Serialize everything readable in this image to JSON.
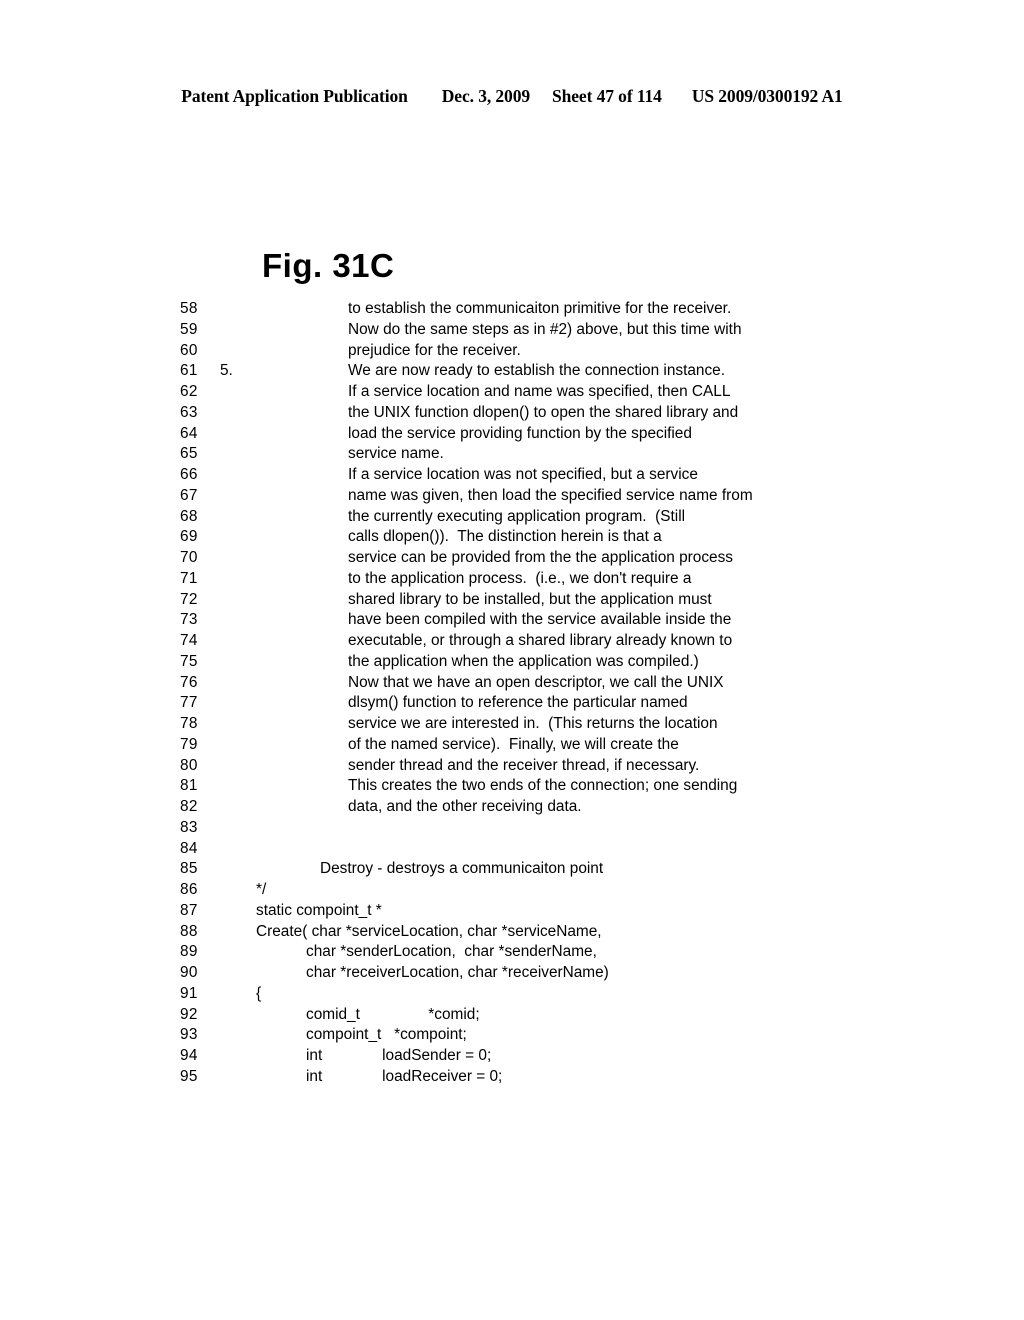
{
  "header": {
    "publication": "Patent Application Publication",
    "date": "Dec. 3, 2009",
    "sheet": "Sheet 47 of 114",
    "patent_number": "US 2009/0300192 A1"
  },
  "figure": {
    "title": "Fig. 31C"
  },
  "listing": {
    "lines": [
      {
        "number": "58",
        "marker": "",
        "indent": "text",
        "text": "to establish the communicaiton primitive for the receiver."
      },
      {
        "number": "59",
        "marker": "",
        "indent": "text",
        "text": "Now do the same steps as in #2) above, but this time with"
      },
      {
        "number": "60",
        "marker": "",
        "indent": "text",
        "text": "prejudice for the receiver."
      },
      {
        "number": "61",
        "marker": "5.",
        "indent": "text",
        "text": "We are now ready to establish the connection instance."
      },
      {
        "number": "62",
        "marker": "",
        "indent": "text",
        "text": "If a service location and name was specified, then CALL"
      },
      {
        "number": "63",
        "marker": "",
        "indent": "text",
        "text": "the UNIX function dlopen() to open the shared library and"
      },
      {
        "number": "64",
        "marker": "",
        "indent": "text",
        "text": "load the service providing function by the specified"
      },
      {
        "number": "65",
        "marker": "",
        "indent": "text",
        "text": "service name."
      },
      {
        "number": "66",
        "marker": "",
        "indent": "text",
        "text": "If a service location was not specified, but a service"
      },
      {
        "number": "67",
        "marker": "",
        "indent": "text",
        "text": "name was given, then load the specified service name from"
      },
      {
        "number": "68",
        "marker": "",
        "indent": "text",
        "text": "the currently executing application program.  (Still"
      },
      {
        "number": "69",
        "marker": "",
        "indent": "text",
        "text": "calls dlopen()).  The distinction herein is that a"
      },
      {
        "number": "70",
        "marker": "",
        "indent": "text",
        "text": "service can be provided from the the application process"
      },
      {
        "number": "71",
        "marker": "",
        "indent": "text",
        "text": "to the application process.  (i.e., we don't require a"
      },
      {
        "number": "72",
        "marker": "",
        "indent": "text",
        "text": "shared library to be installed, but the application must"
      },
      {
        "number": "73",
        "marker": "",
        "indent": "text",
        "text": "have been compiled with the service available inside the"
      },
      {
        "number": "74",
        "marker": "",
        "indent": "text",
        "text": "executable, or through a shared library already known to"
      },
      {
        "number": "75",
        "marker": "",
        "indent": "text",
        "text": "the application when the application was compiled.)"
      },
      {
        "number": "76",
        "marker": "",
        "indent": "text",
        "text": "Now that we have an open descriptor, we call the UNIX"
      },
      {
        "number": "77",
        "marker": "",
        "indent": "text",
        "text": "dlsym() function to reference the particular named"
      },
      {
        "number": "78",
        "marker": "",
        "indent": "text",
        "text": "service we are interested in.  (This returns the location"
      },
      {
        "number": "79",
        "marker": "",
        "indent": "text",
        "text": "of the named service).  Finally, we will create the"
      },
      {
        "number": "80",
        "marker": "",
        "indent": "text",
        "text": "sender thread and the receiver thread, if necessary."
      },
      {
        "number": "81",
        "marker": "",
        "indent": "text",
        "text": "This creates the two ends of the connection; one sending"
      },
      {
        "number": "82",
        "marker": "",
        "indent": "text",
        "text": "data, and the other receiving data."
      },
      {
        "number": "83",
        "marker": "",
        "indent": "text",
        "text": ""
      },
      {
        "number": "84",
        "marker": "",
        "indent": "text",
        "text": ""
      },
      {
        "number": "85",
        "marker": "",
        "indent": "cmt",
        "text": "Destroy - destroys a communicaiton point"
      },
      {
        "number": "86",
        "marker": "",
        "indent": "code0",
        "text": "*/"
      },
      {
        "number": "87",
        "marker": "",
        "indent": "code0",
        "text": "static compoint_t *"
      },
      {
        "number": "88",
        "marker": "",
        "indent": "code0",
        "text": "Create( char *serviceLocation, char *serviceName,"
      },
      {
        "number": "89",
        "marker": "",
        "indent": "code1",
        "text": "char *senderLocation,  char *senderName,"
      },
      {
        "number": "90",
        "marker": "",
        "indent": "code1",
        "text": "char *receiverLocation, char *receiverName)"
      },
      {
        "number": "91",
        "marker": "",
        "indent": "code0",
        "text": "{"
      },
      {
        "number": "92",
        "marker": "",
        "indent": "code1",
        "text": "comid_t                *comid;"
      },
      {
        "number": "93",
        "marker": "",
        "indent": "code1",
        "text": "compoint_t   *compoint;"
      },
      {
        "number": "94",
        "marker": "",
        "indent": "code1",
        "text": "int              loadSender = 0;"
      },
      {
        "number": "95",
        "marker": "",
        "indent": "code1",
        "text": "int              loadReceiver = 0;"
      }
    ]
  }
}
